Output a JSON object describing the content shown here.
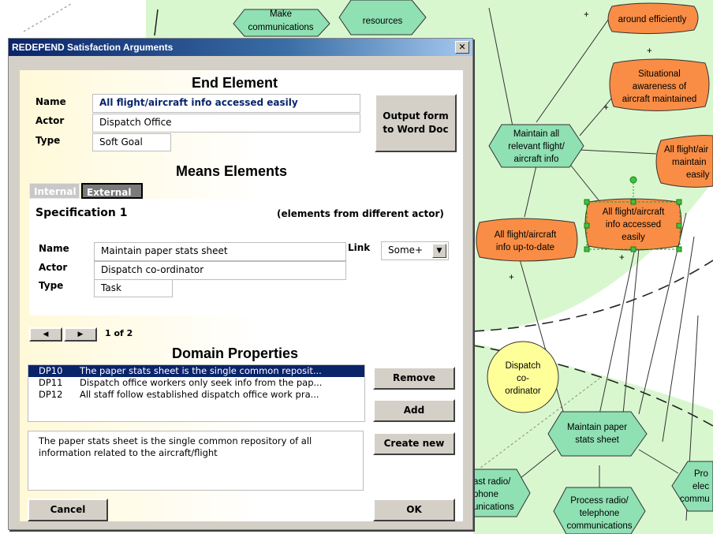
{
  "dialog": {
    "title": "REDEPEND Satisfaction Arguments",
    "close_glyph": "✕",
    "end_element": {
      "heading": "End Element",
      "name_label": "Name",
      "name_value": "All flight/aircraft info accessed easily",
      "actor_label": "Actor",
      "actor_value": "Dispatch Office",
      "type_label": "Type",
      "type_value": "Soft Goal",
      "output_button": "Output form to Word Doc"
    },
    "means": {
      "heading": "Means Elements",
      "tabs": [
        "Internal",
        "External"
      ],
      "active_tab": "External",
      "spec_title": "Specification 1",
      "spec_note": "(elements from different actor)",
      "name_label": "Name",
      "name_value": "Maintain paper stats sheet",
      "link_label": "Link",
      "link_value": "Some+",
      "actor_label": "Actor",
      "actor_value": "Dispatch co-ordinator",
      "type_label": "Type",
      "type_value": "Task"
    },
    "pager": {
      "text": "1 of 2",
      "prev_glyph": "◀",
      "next_glyph": "▶"
    },
    "domain": {
      "heading": "Domain Properties",
      "items": [
        {
          "id": "DP10",
          "text": "The paper stats sheet is the single common reposit...",
          "selected": true
        },
        {
          "id": "DP11",
          "text": "Dispatch office workers only seek info from the pap..."
        },
        {
          "id": "DP12",
          "text": "All staff follow established dispatch office work pra..."
        }
      ],
      "description": "The paper stats sheet is the single common repository of all information related to the aircraft/flight",
      "remove_button": "Remove",
      "add_button": "Add",
      "create_button": "Create new"
    },
    "cancel_button": "Cancel",
    "ok_button": "OK"
  },
  "diagram": {
    "nodes": {
      "make_comm": "Make communications",
      "allocate": "Allocate resources",
      "around": "around efficiently",
      "situational": "Situational awareness of aircraft maintained",
      "maintain_all": "Maintain all relevant flight/ aircraft info",
      "all_flight_right": "All flight/air maintain easily",
      "accessed": "All flight/aircraft info accessed easily",
      "up_to_date": "All flight/aircraft info up-to-date",
      "dispatch_coord": "Dispatch co- ordinator",
      "maintain_paper": "Maintain paper stats sheet",
      "cast_radio": "ast radio/ phone unications",
      "process_radio": "Process radio/ telephone communications",
      "pro_elec": "Pro elec commu"
    },
    "plus": "+"
  }
}
